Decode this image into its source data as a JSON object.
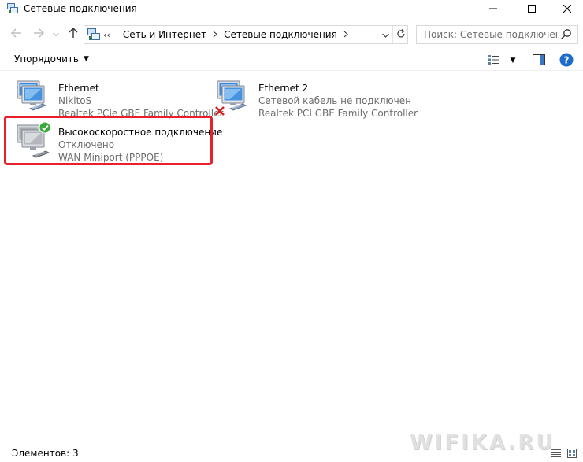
{
  "window": {
    "title": "Сетевые подключения",
    "icon": "network-connections-icon",
    "controls": [
      "minimize-icon",
      "maximize-icon",
      "close-icon"
    ]
  },
  "navigation": {
    "back_icon": "arrow-left-icon",
    "forward_icon": "arrow-right-icon",
    "recent_icon": "chevron-down-icon",
    "up_icon": "arrow-up-icon",
    "overflow": "‹‹",
    "breadcrumbs": [
      "Сеть и Интернет",
      "Сетевые подключения"
    ],
    "refresh_icon": "refresh-icon",
    "search_placeholder": "Поиск: Сетевые подключения",
    "search_icon": "search-icon"
  },
  "toolbar": {
    "organize_label": "Упорядочить",
    "view_icon": "change-view-icon",
    "preview_icon": "preview-pane-icon",
    "help_icon": "help-icon"
  },
  "connections": [
    {
      "name": "Ethernet",
      "status": "NikitoS",
      "device": "Realtek PCIe GBE Family Controller",
      "state": "connected",
      "icon": "ethernet-adapter-icon"
    },
    {
      "name": "Ethernet 2",
      "status": "Сетевой кабель не подключен",
      "device": "Realtek PCI GBE Family Controller",
      "state": "cable-unplugged",
      "icon": "ethernet-adapter-icon"
    },
    {
      "name": "Высокоскоростное подключение",
      "status": "Отключено",
      "device": "WAN Miniport (PPPOE)",
      "state": "disconnected",
      "icon": "broadband-connection-icon"
    }
  ],
  "highlight_color": "#e8202a",
  "status_bar": {
    "item_count": "Элементов: 3"
  },
  "watermark": "WIFIKA.RU"
}
